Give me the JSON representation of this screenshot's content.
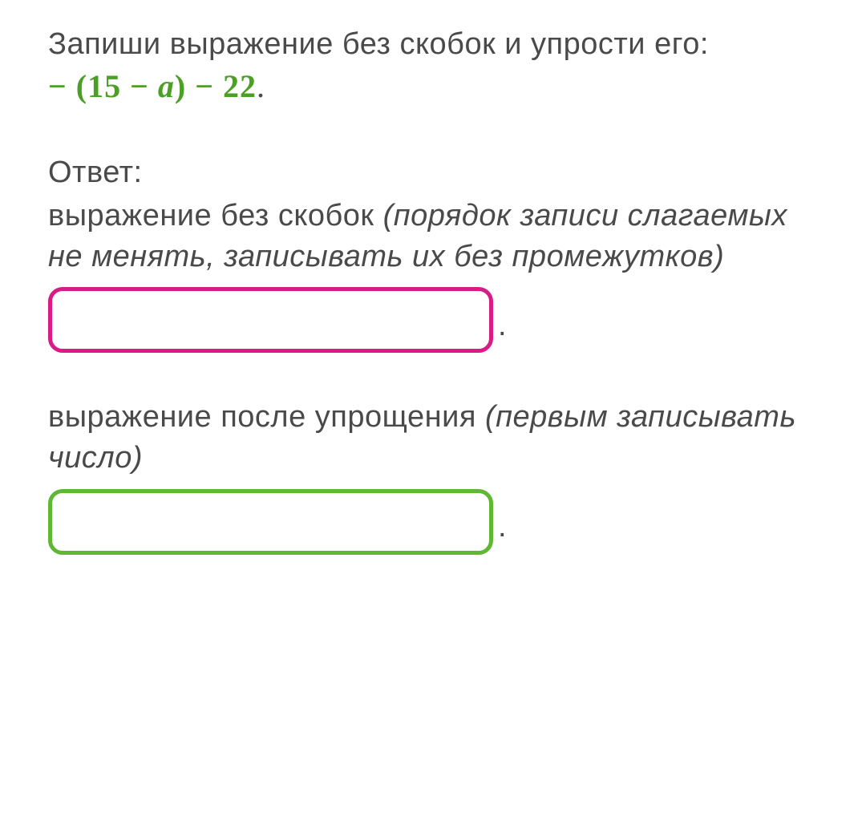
{
  "problem": {
    "instruction": "Запиши выражение без скобок и упрости его:",
    "expression_prefix": "− (15 − ",
    "expression_var": "a",
    "expression_suffix": ") − 22",
    "period": "."
  },
  "answer": {
    "label": "Ответ:",
    "field1": {
      "label": "выражение без скобок ",
      "hint": "(порядок записи слагаемых не менять, записывать их без промежутков)",
      "value": ""
    },
    "field2": {
      "label": "выражение после упрощения ",
      "hint": "(первым записывать число)",
      "value": ""
    },
    "period": "."
  }
}
